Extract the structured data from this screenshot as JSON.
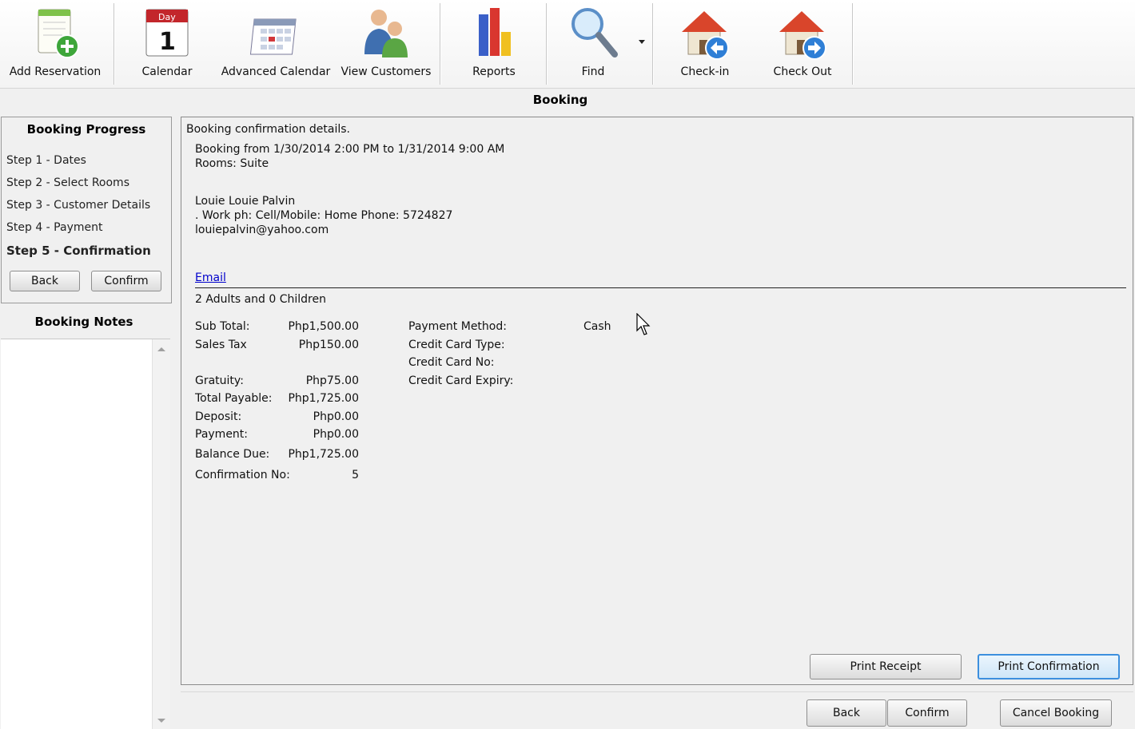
{
  "toolbar": {
    "add_reservation": "Add Reservation",
    "calendar": "Calendar",
    "calendar_day": "Day",
    "calendar_number": "1",
    "advanced_calendar": "Advanced Calendar",
    "view_customers": "View Customers",
    "reports": "Reports",
    "find": "Find",
    "check_in": "Check-in",
    "check_out": "Check Out"
  },
  "header": {
    "title": "Booking"
  },
  "progress": {
    "title": "Booking Progress",
    "steps": [
      "Step 1 - Dates",
      "Step 2 - Select Rooms",
      "Step 3 - Customer Details",
      "Step 4 - Payment",
      "Step 5 - Confirmation"
    ],
    "back": "Back",
    "confirm": "Confirm"
  },
  "notes": {
    "title": "Booking Notes"
  },
  "details": {
    "heading": "Booking confirmation details.",
    "booking_range": "Booking from 1/30/2014 2:00 PM to 1/31/2014 9:00 AM",
    "rooms": "Rooms: Suite",
    "customer_name": "Louie Louie Palvin",
    "phones": ". Work ph:  Cell/Mobile:  Home Phone: 5724827",
    "email_address": "louiepalvin@yahoo.com",
    "email_link": "Email",
    "guests": "2 Adults and 0 Children"
  },
  "totals": {
    "sub_total_label": "Sub Total:",
    "sub_total": "Php1,500.00",
    "sales_tax_label": "Sales Tax",
    "sales_tax": "Php150.00",
    "gratuity_label": "Gratuity:",
    "gratuity": "Php75.00",
    "total_payable_label": "Total Payable:",
    "total_payable": "Php1,725.00",
    "deposit_label": "Deposit:",
    "deposit": "Php0.00",
    "payment_label": "Payment:",
    "payment": "Php0.00",
    "balance_due_label": "Balance Due:",
    "balance_due": "Php1,725.00",
    "confirmation_no_label": "Confirmation No:",
    "confirmation_no": "5"
  },
  "payment_info": {
    "method_label": "Payment Method:",
    "method": "Cash",
    "card_type_label": "Credit Card Type:",
    "card_no_label": "Credit Card No:",
    "card_expiry_label": "Credit Card Expiry:"
  },
  "panel_buttons": {
    "print_receipt": "Print Receipt",
    "print_confirmation": "Print Confirmation"
  },
  "footer_buttons": {
    "back": "Back",
    "confirm": "Confirm",
    "cancel_booking": "Cancel Booking"
  },
  "colors": {
    "link": "#0000cc",
    "focus_border": "#3c8fde",
    "house_roof": "#d9452b",
    "arrow_blue": "#2f7fd6"
  }
}
